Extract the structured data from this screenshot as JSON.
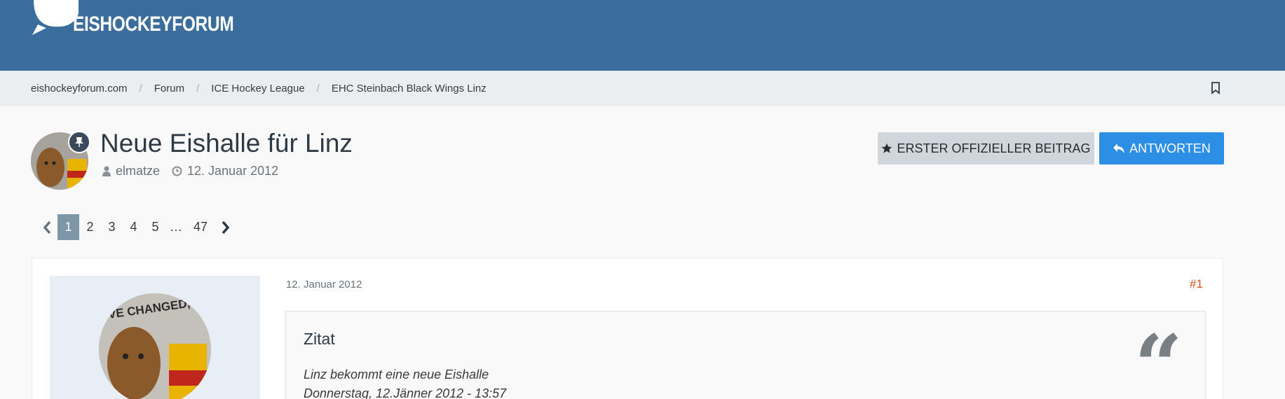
{
  "header": {
    "logo_text": "EISHOCKEYFORUM"
  },
  "breadcrumb": [
    {
      "label": "eishockeyforum.com"
    },
    {
      "label": "Forum"
    },
    {
      "label": "ICE Hockey League"
    },
    {
      "label": "EHC Steinbach Black Wings Linz"
    }
  ],
  "thread": {
    "title": "Neue Eishalle für Linz",
    "author": "elmatze",
    "date": "12. Januar 2012"
  },
  "buttons": {
    "first_post": "ERSTER OFFIZIELLER BEITRAG",
    "reply": "ANTWORTEN"
  },
  "pagination": {
    "pages": [
      "1",
      "2",
      "3",
      "4",
      "5"
    ],
    "dots": "…",
    "last": "47",
    "active": 1
  },
  "post": {
    "date": "12. Januar 2012",
    "number": "#1",
    "quote": {
      "title": "Zitat",
      "line1": "Linz bekommt eine neue Eishalle",
      "line2": "Donnerstag, 12.Jänner 2012 - 13:57",
      "mark": "“"
    }
  },
  "colors": {
    "header_bg": "#3a6d9c",
    "reply_button": "#2c8fe5",
    "active_page": "#7d96a8",
    "post_number": "#d4521e"
  }
}
